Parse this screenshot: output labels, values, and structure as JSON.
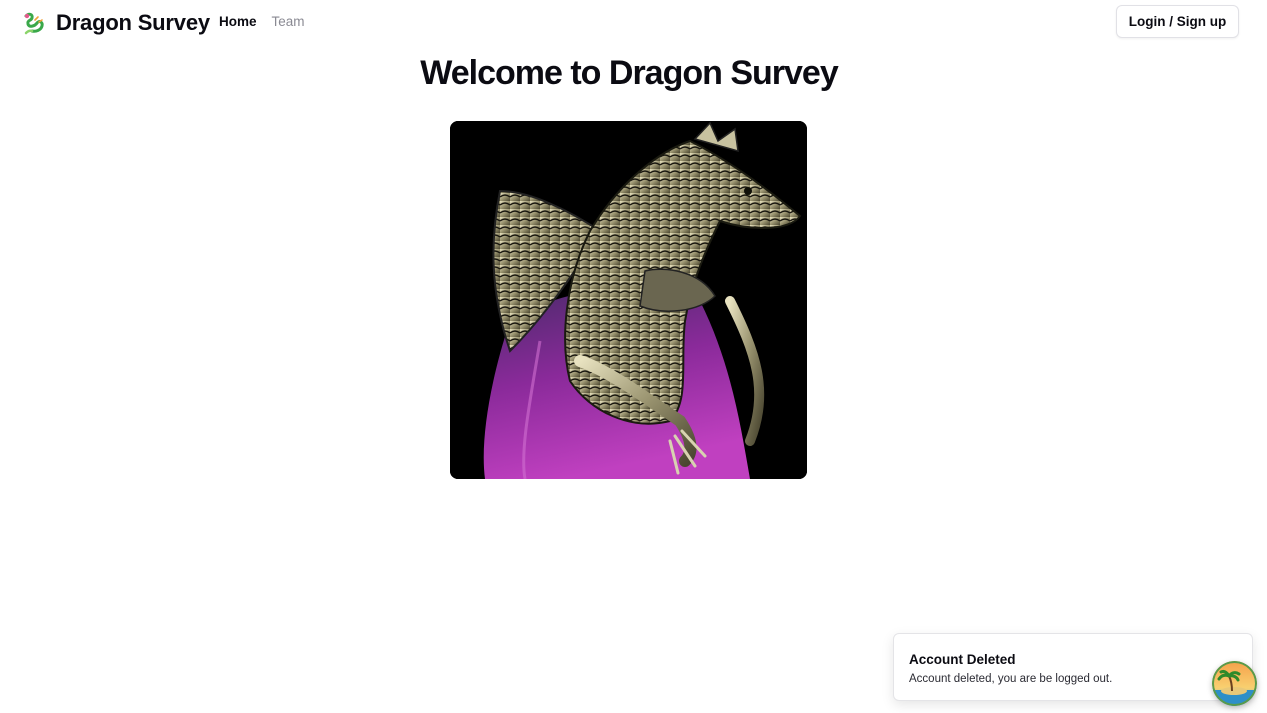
{
  "header": {
    "brand_name": "Dragon Survey",
    "brand_icon": "dragon-logo-icon",
    "nav": [
      {
        "label": "Home",
        "active": true
      },
      {
        "label": "Team",
        "active": false
      }
    ],
    "login_label": "Login / Sign up"
  },
  "main": {
    "title": "Welcome to Dragon Survey",
    "hero_image": "dragon-statue-image"
  },
  "toast": {
    "title": "Account Deleted",
    "description": "Account deleted, you are be logged out."
  },
  "floating_avatar": "island-avatar-icon"
}
